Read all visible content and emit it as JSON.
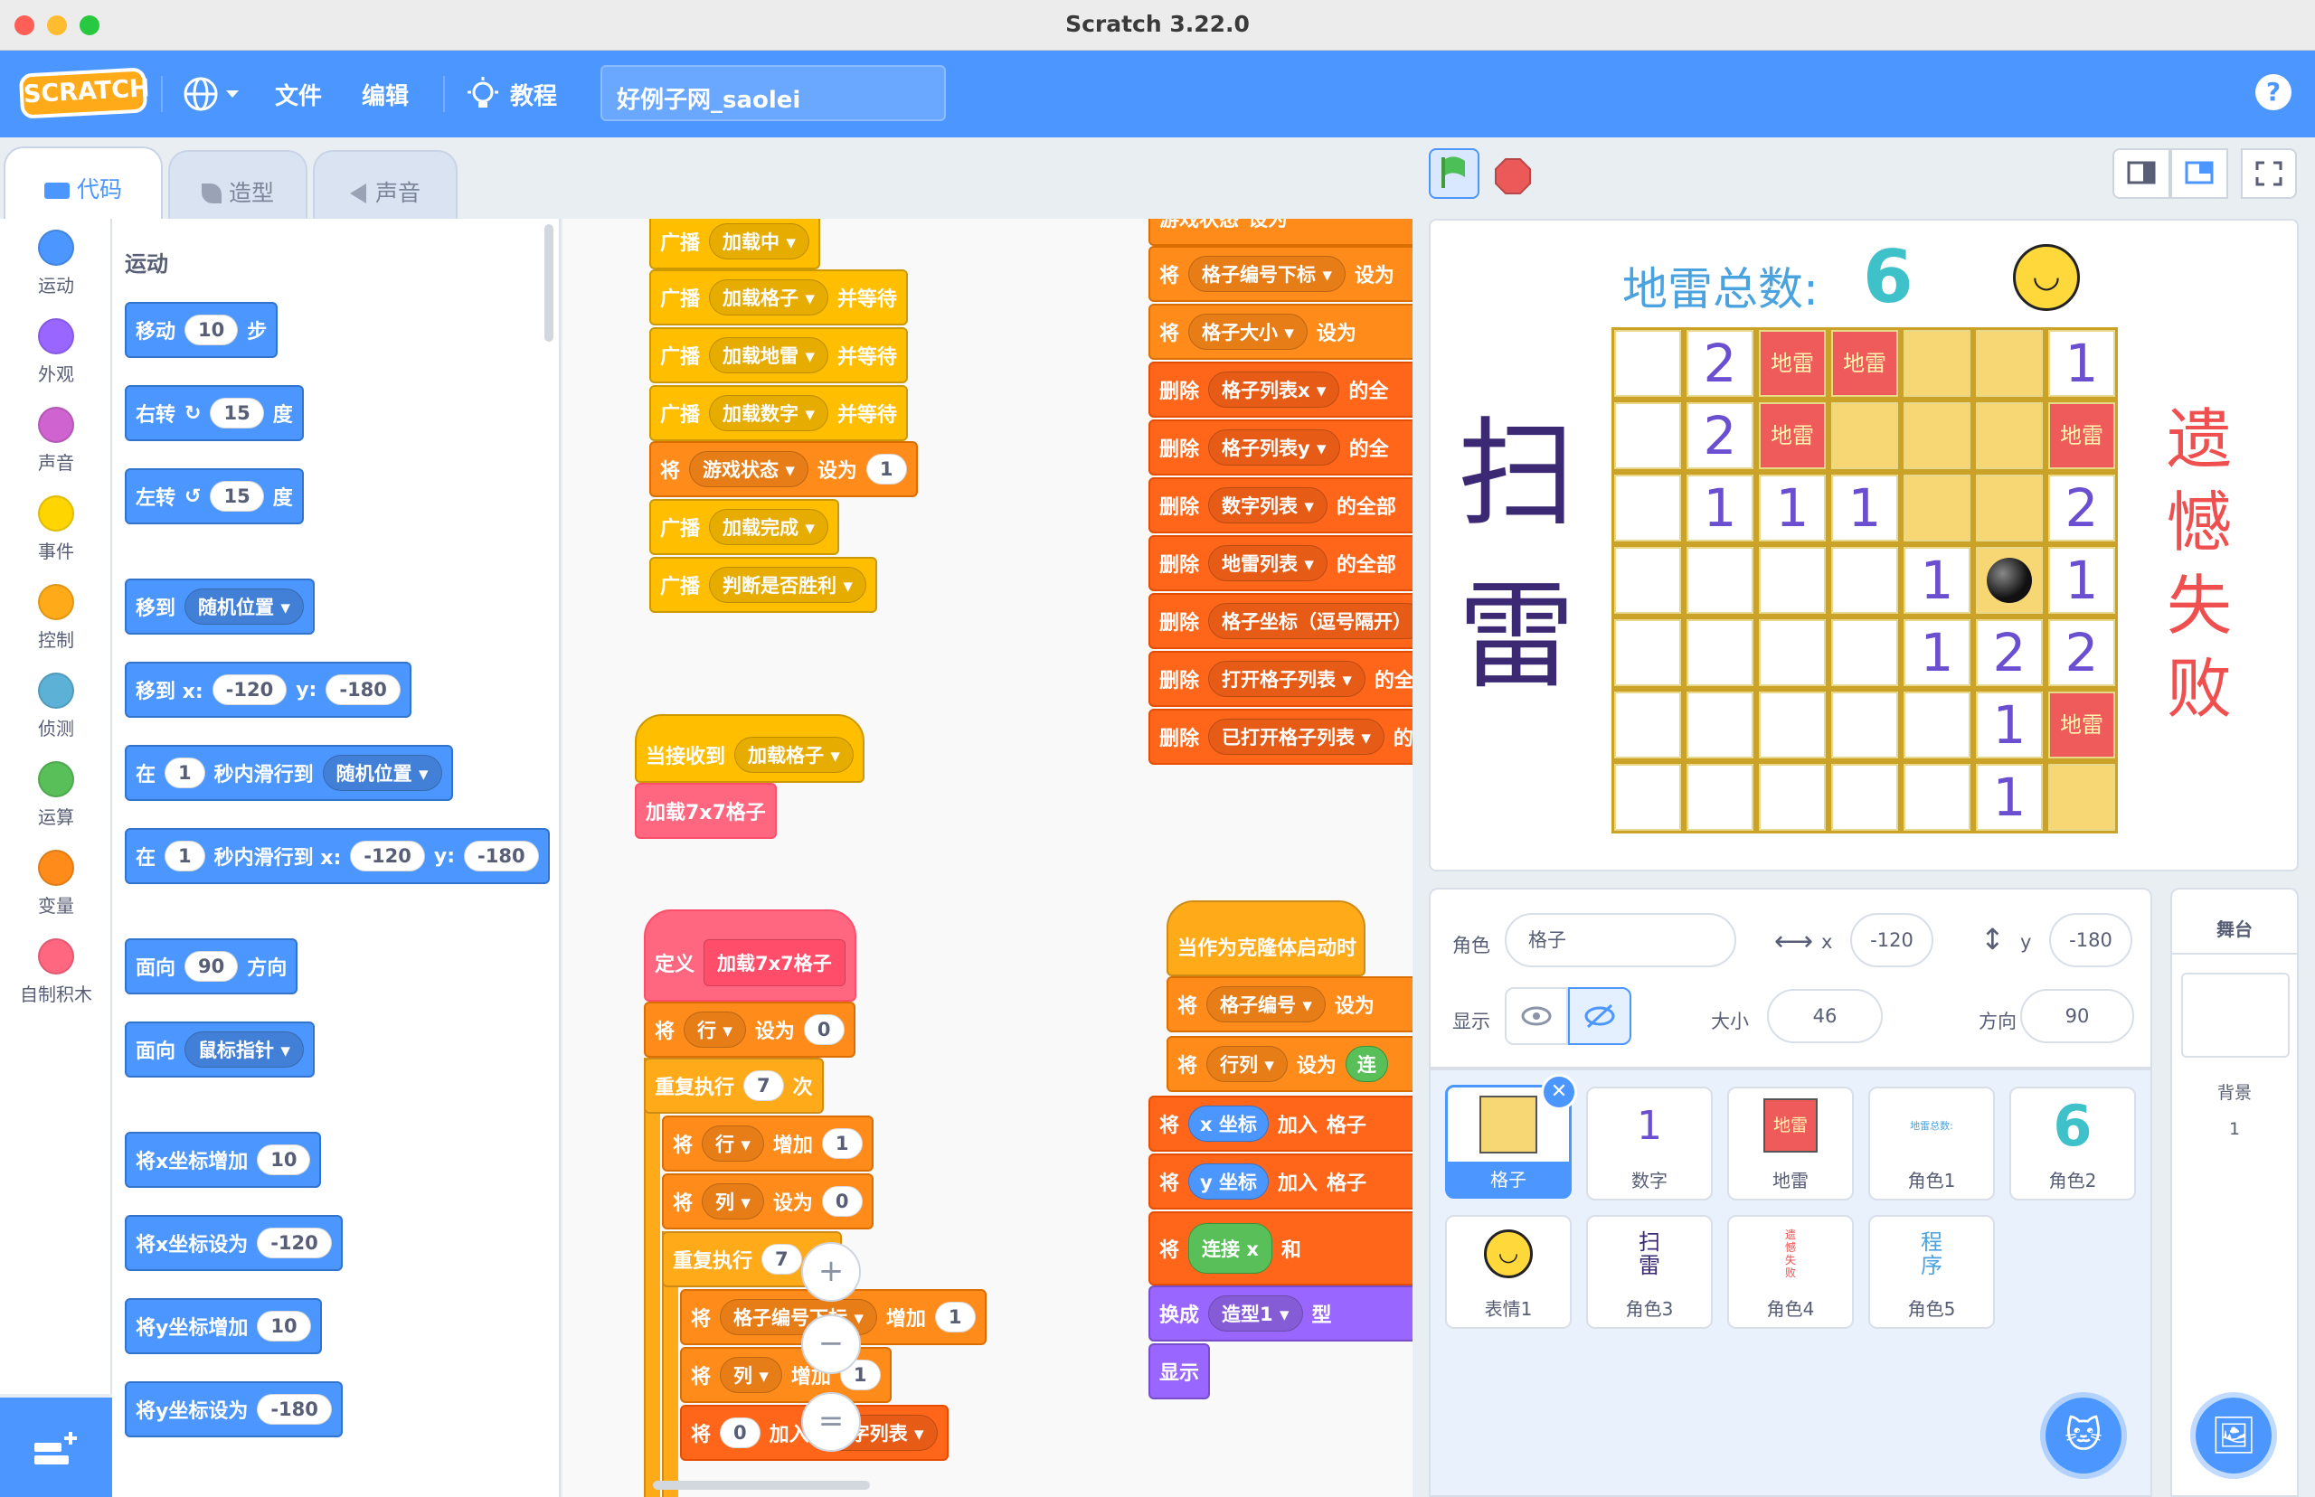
{
  "window": {
    "title": "Scratch 3.22.0"
  },
  "menu": {
    "logo": "SCRATCH",
    "file": "文件",
    "edit": "编辑",
    "tutorials": "教程",
    "project_title": "好例子网_saolei",
    "help": "?"
  },
  "tabs": {
    "code": "代码",
    "costumes": "造型",
    "sounds": "声音"
  },
  "categories": [
    {
      "label": "运动",
      "color": "#4c97ff"
    },
    {
      "label": "外观",
      "color": "#9966ff"
    },
    {
      "label": "声音",
      "color": "#cf63cf"
    },
    {
      "label": "事件",
      "color": "#ffd500"
    },
    {
      "label": "控制",
      "color": "#ffab19"
    },
    {
      "label": "侦测",
      "color": "#5cb1d6"
    },
    {
      "label": "运算",
      "color": "#59c059"
    },
    {
      "label": "变量",
      "color": "#ff8c1a"
    },
    {
      "label": "自制积木",
      "color": "#ff6680"
    }
  ],
  "palette": {
    "heading": "运动",
    "move": {
      "a": "移动",
      "n": "10",
      "b": "步"
    },
    "turn_right": {
      "a": "右转",
      "n": "15",
      "b": "度"
    },
    "turn_left": {
      "a": "左转",
      "n": "15",
      "b": "度"
    },
    "goto": {
      "a": "移到",
      "dd": "随机位置"
    },
    "goto_xy": {
      "a": "移到 x:",
      "x": "-120",
      "ylab": "y:",
      "y": "-180"
    },
    "glide": {
      "a": "在",
      "n": "1",
      "b": "秒内滑行到",
      "dd": "随机位置"
    },
    "glide_xy": {
      "a": "在",
      "n": "1",
      "b": "秒内滑行到 x:",
      "x": "-120",
      "ylab": "y:",
      "y": "-180"
    },
    "point_dir": {
      "a": "面向",
      "n": "90",
      "b": "方向"
    },
    "point_towards": {
      "a": "面向",
      "dd": "鼠标指针"
    },
    "change_x": {
      "a": "将x坐标增加",
      "n": "10"
    },
    "set_x": {
      "a": "将x坐标设为",
      "n": "-120"
    },
    "change_y": {
      "a": "将y坐标增加",
      "n": "10"
    },
    "set_y": {
      "a": "将y坐标设为",
      "n": "-180"
    }
  },
  "script1": {
    "b0": {
      "a": "广播",
      "dd": "加载中"
    },
    "b1": {
      "a": "广播",
      "dd": "加载格子",
      "b": "并等待"
    },
    "b2": {
      "a": "广播",
      "dd": "加载地雷",
      "b": "并等待"
    },
    "b3": {
      "a": "广播",
      "dd": "加载数字",
      "b": "并等待"
    },
    "b4": {
      "a": "将",
      "dd": "游戏状态",
      "b": "设为",
      "n": "1"
    },
    "b5": {
      "a": "广播",
      "dd": "加载完成"
    },
    "b6": {
      "a": "广播",
      "dd": "判断是否胜利"
    }
  },
  "script2": {
    "b0": {
      "a": "游戏状态",
      "dd": "",
      "b": "设为"
    },
    "b1": {
      "a": "将",
      "dd": "格子编号下标",
      "b": "设为"
    },
    "b2": {
      "a": "将",
      "dd": "格子大小",
      "b": "设为"
    },
    "b3": {
      "a": "删除",
      "dd": "格子列表x",
      "b": "的全"
    },
    "b4": {
      "a": "删除",
      "dd": "格子列表y",
      "b": "的全"
    },
    "b5": {
      "a": "删除",
      "dd": "数字列表",
      "b": "的全部"
    },
    "b6": {
      "a": "删除",
      "dd": "地雷列表",
      "b": "的全部"
    },
    "b7": {
      "a": "删除",
      "dd": "格子坐标（逗号隔开）"
    },
    "b8": {
      "a": "删除",
      "dd": "打开格子列表",
      "b": "的全"
    },
    "b9": {
      "a": "删除",
      "dd": "已打开格子列表",
      "b": "的"
    }
  },
  "script3": {
    "hat": {
      "a": "当接收到",
      "dd": "加载格子"
    },
    "call": "加载7x7格子"
  },
  "script4": {
    "define": {
      "a": "定义",
      "name": "加载7x7格子"
    },
    "set_row": {
      "a": "将",
      "dd": "行",
      "b": "设为",
      "n": "0"
    },
    "repeat1": {
      "a": "重复执行",
      "n": "7",
      "b": "次"
    },
    "change_row": {
      "a": "将",
      "dd": "行",
      "b": "增加",
      "n": "1"
    },
    "set_col": {
      "a": "将",
      "dd": "列",
      "b": "设为",
      "n": "0"
    },
    "repeat2": {
      "a": "重复执行",
      "n": "7",
      "b": "次"
    },
    "change_idx": {
      "a": "将",
      "dd": "格子编号下标",
      "b": "增加",
      "n": "1"
    },
    "change_col": {
      "a": "将",
      "dd": "列",
      "b": "增加",
      "n": "1"
    },
    "add_list": {
      "a": "将",
      "n": "0",
      "b": "加入",
      "dd": "数字列表"
    }
  },
  "script5": {
    "hat": "当作为克隆体启动时",
    "b1": {
      "a": "将",
      "dd": "格子编号",
      "b": "设为"
    },
    "b2": {
      "a": "将",
      "dd": "行列",
      "b": "设为",
      "c": "连"
    },
    "b3": {
      "a": "将",
      "rep": "x 坐标",
      "b": "加入",
      "c": "格子"
    },
    "b4": {
      "a": "将",
      "rep": "y 坐标",
      "b": "加入",
      "c": "格子"
    },
    "b5": {
      "a": "将",
      "op": "连接",
      "op2": "x",
      "b": "和"
    },
    "b6": {
      "a": "换成",
      "dd": "造型1",
      "b": "型"
    },
    "b7": "显示"
  },
  "zoom": {
    "in": "+",
    "out": "−",
    "reset": "="
  },
  "stage": {
    "mine_label": "地雷总数:",
    "mine_count": "6",
    "title_chars": [
      "扫",
      "雷"
    ],
    "fail_chars": [
      "遗",
      "憾",
      "失",
      "败"
    ],
    "grid": [
      [
        "",
        "2",
        "地雷",
        "地雷",
        "Y",
        "Y",
        "1"
      ],
      [
        "",
        "2",
        "地雷",
        "Y",
        "Y",
        "Y",
        "地雷"
      ],
      [
        "",
        "1",
        "1",
        "1",
        "Y",
        "Y",
        "2"
      ],
      [
        "",
        "",
        "",
        "",
        "1",
        "BOMB",
        "1"
      ],
      [
        "",
        "",
        "",
        "",
        "1",
        "2",
        "2"
      ],
      [
        "",
        "",
        "",
        "",
        "",
        "1",
        "地雷"
      ],
      [
        "",
        "",
        "",
        "",
        "",
        "1",
        "Y"
      ]
    ]
  },
  "sprite_info": {
    "sprite_label": "角色",
    "sprite_name": "格子",
    "x_label": "x",
    "x": "-120",
    "y_label": "y",
    "y": "-180",
    "show_label": "显示",
    "size_label": "大小",
    "size": "46",
    "direction_label": "方向",
    "direction": "90"
  },
  "sprites": [
    {
      "name": "格子",
      "thumb": "square"
    },
    {
      "name": "数字",
      "thumb": "1"
    },
    {
      "name": "地雷",
      "thumb": "地雷"
    },
    {
      "name": "角色1",
      "thumb": "地雷总数:"
    },
    {
      "name": "角色2",
      "thumb": "6"
    },
    {
      "name": "表情1",
      "thumb": "face"
    },
    {
      "name": "角色3",
      "thumb": "扫雷"
    },
    {
      "name": "角色4",
      "thumb": "遗憾失败"
    },
    {
      "name": "角色5",
      "thumb": "程序"
    }
  ],
  "stage_pane": {
    "title": "舞台",
    "backdrop_label": "背景",
    "backdrop_count": "1"
  }
}
